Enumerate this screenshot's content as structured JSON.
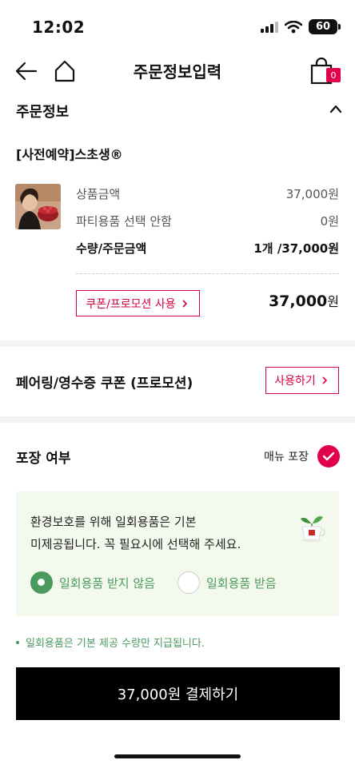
{
  "status_bar": {
    "time": "12:02",
    "battery": "60"
  },
  "header": {
    "title": "주문정보입력",
    "cart_count": "0"
  },
  "order_info": {
    "title": "주문정보",
    "product_name": "[사전예약]스초생®",
    "rows": [
      {
        "label": "상품금액",
        "value": "37,000원"
      },
      {
        "label": "파티용품 선택 안함",
        "value": "0원"
      },
      {
        "label": "수량/주문금액",
        "value": "1개 /37,000원"
      }
    ],
    "coupon_button": "쿠폰/프로모션 사용",
    "total_amount": "37,000",
    "total_unit": "원"
  },
  "pairing": {
    "title": "페어링/영수증 쿠폰 (프로모션)",
    "use_button": "사용하기"
  },
  "packaging": {
    "title": "포장 여부",
    "option_label": "매뉴 포장",
    "eco_message_line1": "환경보호를 위해 일회용품은 기본",
    "eco_message_line2": "미제공됩니다. 꼭 필요시에 선택해 주세요.",
    "radio_no": "일회용품 받지 않음",
    "radio_yes": "일회용품 받음",
    "selected": "no",
    "note": "일회용품은 기본 제공 수량만 지급됩니다."
  },
  "pay_button": "37,000원 결제하기",
  "colors": {
    "accent": "#e0004d",
    "eco_green": "#4a9a5d",
    "eco_bg": "#f4f9ee"
  }
}
